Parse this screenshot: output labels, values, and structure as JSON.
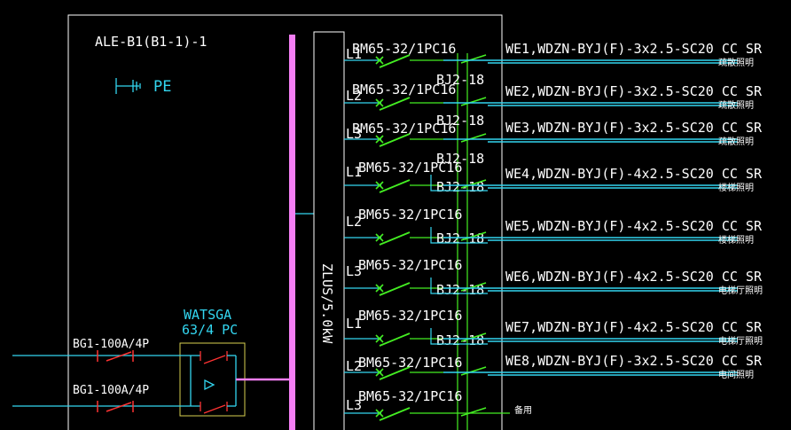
{
  "panel": {
    "title": "ALE-B1(B1-1)-1",
    "pe_label": "PE"
  },
  "incoming": [
    {
      "label": "BG1-100A/4P"
    },
    {
      "label": "BG1-100A/4P"
    }
  ],
  "ats": {
    "line1": "WATSGA",
    "line2": "63/4 PC"
  },
  "bus": {
    "label": "ZLUS/5.0kW"
  },
  "circuits": [
    {
      "phase": "L1",
      "breaker": "BM65-32/1PC16",
      "bj": "BJ2-18",
      "cable": "WE1,WDZN-BYJ(F)-3x2.5-SC20 CC SR",
      "load": "疏散照明"
    },
    {
      "phase": "L2",
      "breaker": "BM65-32/1PC16",
      "bj": "BJ2-18",
      "cable": "WE2,WDZN-BYJ(F)-3x2.5-SC20 CC SR",
      "load": "疏散照明"
    },
    {
      "phase": "L3",
      "breaker": "BM65-32/1PC16",
      "bj": "BJ2-18",
      "cable": "WE3,WDZN-BYJ(F)-3x2.5-SC20 CC SR",
      "load": "疏散照明"
    },
    {
      "phase": "L1",
      "breaker": "BM65-32/1PC16",
      "bj": "BJ2-18",
      "cable": "WE4,WDZN-BYJ(F)-4x2.5-SC20 CC SR",
      "load": "楼梯照明"
    },
    {
      "phase": "L2",
      "breaker": "BM65-32/1PC16",
      "bj": "BJ2-18",
      "cable": "WE5,WDZN-BYJ(F)-4x2.5-SC20 CC SR",
      "load": "楼梯照明"
    },
    {
      "phase": "L3",
      "breaker": "BM65-32/1PC16",
      "bj": "BJ2-18",
      "cable": "WE6,WDZN-BYJ(F)-4x2.5-SC20 CC SR",
      "load": "电梯厅照明"
    },
    {
      "phase": "L1",
      "breaker": "BM65-32/1PC16",
      "bj": "BJ2-18",
      "cable": "WE7,WDZN-BYJ(F)-4x2.5-SC20 CC SR",
      "load": "电梯厅照明"
    },
    {
      "phase": "L2",
      "breaker": "BM65-32/1PC16",
      "bj": "",
      "cable": "WE8,WDZN-BYJ(F)-3x2.5-SC20 CC SR",
      "load": "电间照明"
    },
    {
      "phase": "L3",
      "breaker": "BM65-32/1PC16",
      "bj": "",
      "cable": "",
      "load": "备用"
    }
  ],
  "colors": {
    "background": "#000000",
    "frame": "#ffffff",
    "cyan": "#33d6f0",
    "green": "#44ee22",
    "red": "#ff3333",
    "magenta": "#f47ef4",
    "ats_box": "#d8d050"
  }
}
